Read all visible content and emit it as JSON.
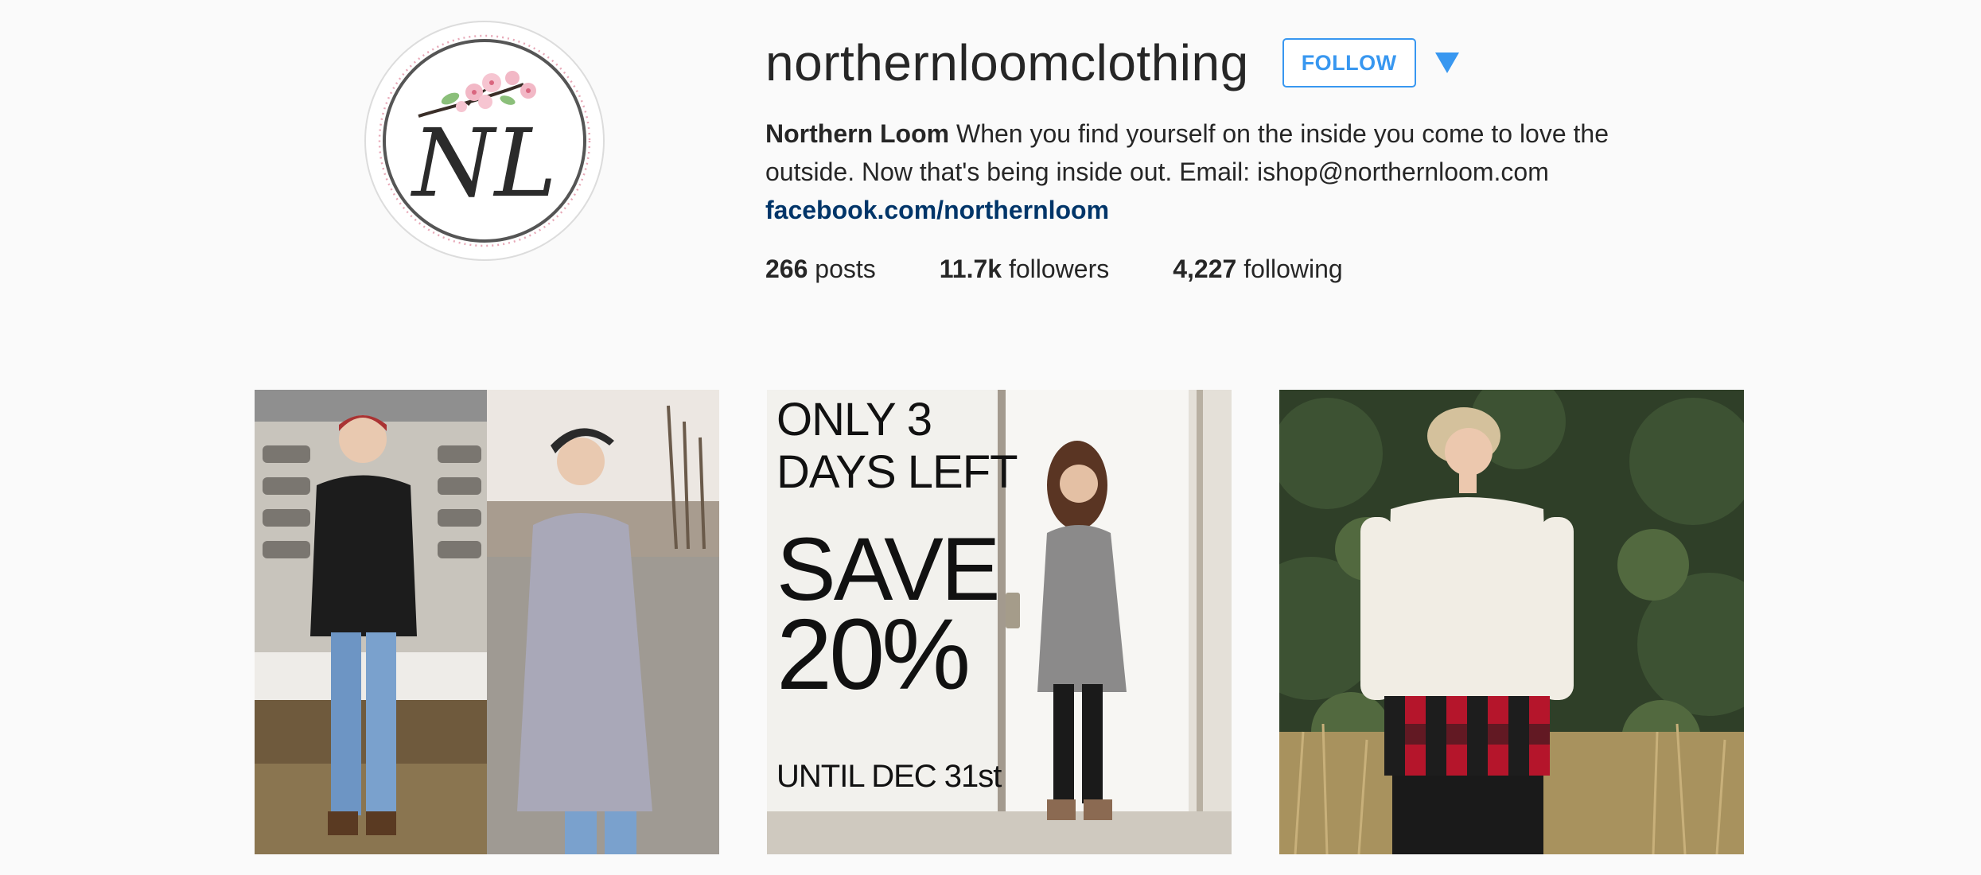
{
  "profile": {
    "username": "northernloomclothing",
    "follow_label": "FOLLOW",
    "avatar_monogram": "NL",
    "full_name": "Northern Loom",
    "bio": " When you find yourself on the inside you come to love the outside. Now that's being inside out. Email: ishop@northernloom.com",
    "link": "facebook.com/northernloom"
  },
  "stats": {
    "posts_count": "266",
    "posts_label": " posts",
    "followers_count": "11.7k",
    "followers_label": " followers",
    "following_count": "4,227",
    "following_label": " following"
  },
  "posts": {
    "promo": {
      "line1": "ONLY 3",
      "line2": "DAYS LEFT",
      "line3": "SAVE",
      "line4": "20%",
      "line5": "UNTIL DEC 31st"
    }
  },
  "colors": {
    "accent": "#3897f0",
    "link": "#003569",
    "background": "#fafafa"
  },
  "icons": {
    "dropdown": "caret-down-icon"
  }
}
